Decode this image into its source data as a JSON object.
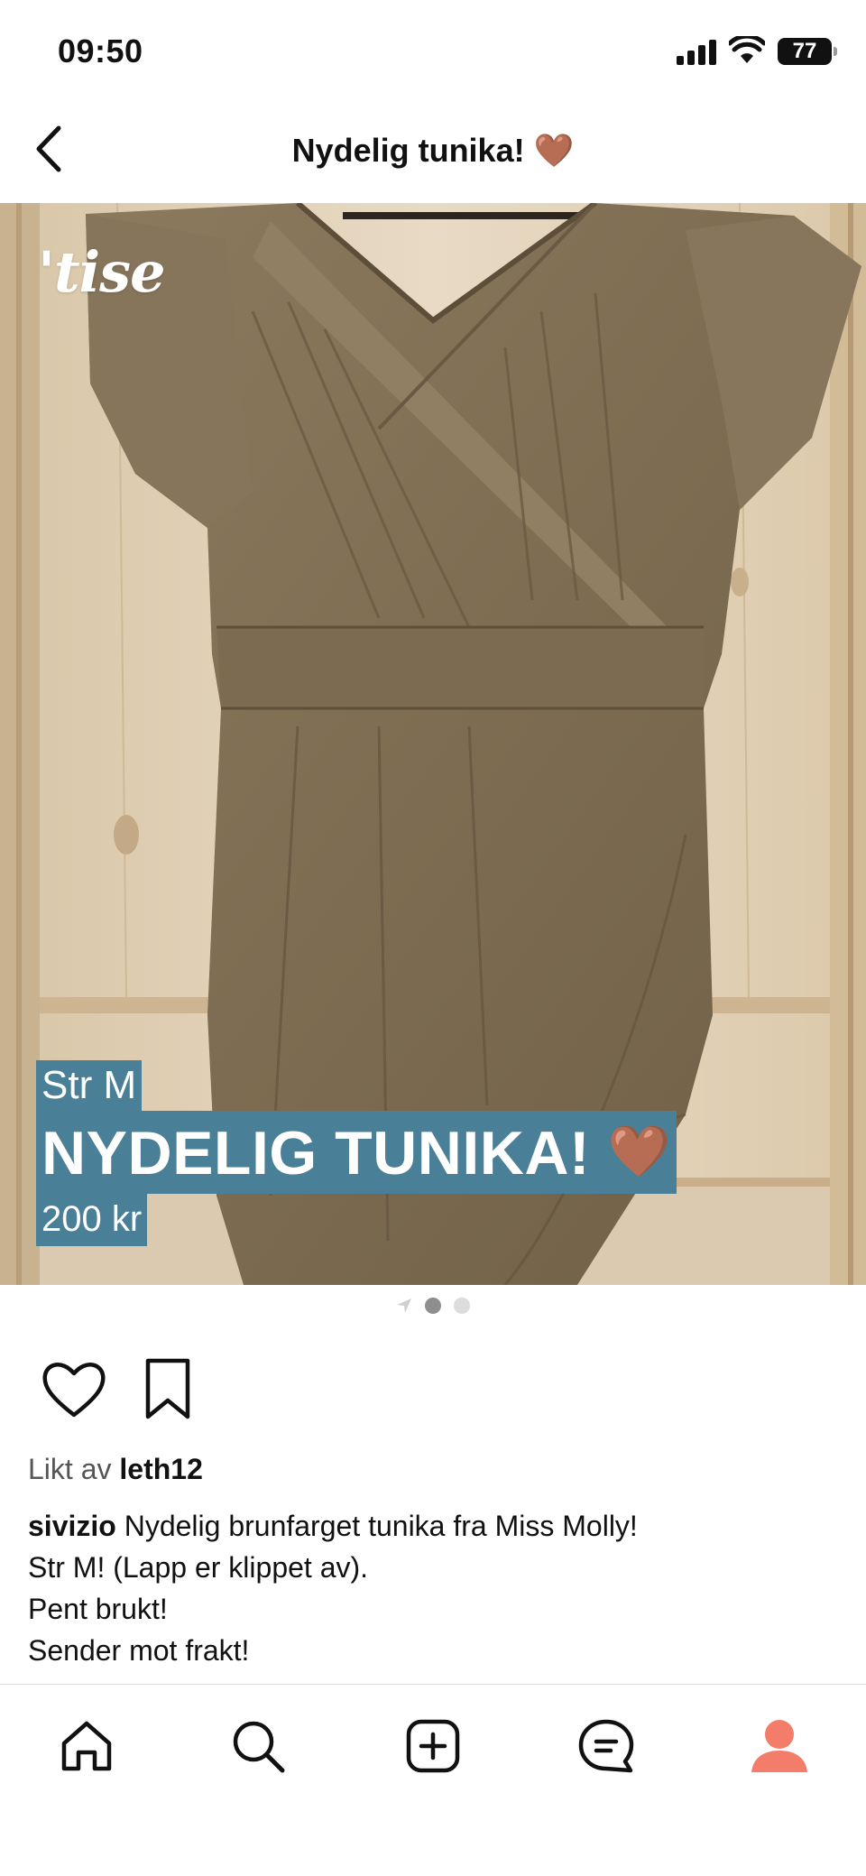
{
  "status_bar": {
    "time": "09:50",
    "battery": "77"
  },
  "header": {
    "title": "Nydelig tunika! 🤎"
  },
  "image": {
    "watermark": "'tise",
    "overlay_size": "Str M",
    "overlay_title": "NYDELIG TUNIKA!",
    "overlay_heart": "🤎",
    "overlay_price": "200 kr",
    "overlay_color": "#4a7f98"
  },
  "pager": {
    "count": 2,
    "active_index": 0
  },
  "likes": {
    "prefix": "Likt av",
    "user": "leth12"
  },
  "caption": {
    "user": "sivizio",
    "line1": "Nydelig brunfarget tunika fra Miss Molly!",
    "line2": "Str M! (Lapp er klippet av).",
    "line3": "Pent brukt!",
    "line4": "Sender mot frakt!"
  },
  "nav": {
    "items": [
      "home-icon",
      "search-icon",
      "add-icon",
      "chat-icon",
      "profile-icon"
    ],
    "profile_color": "#f47c6a"
  }
}
